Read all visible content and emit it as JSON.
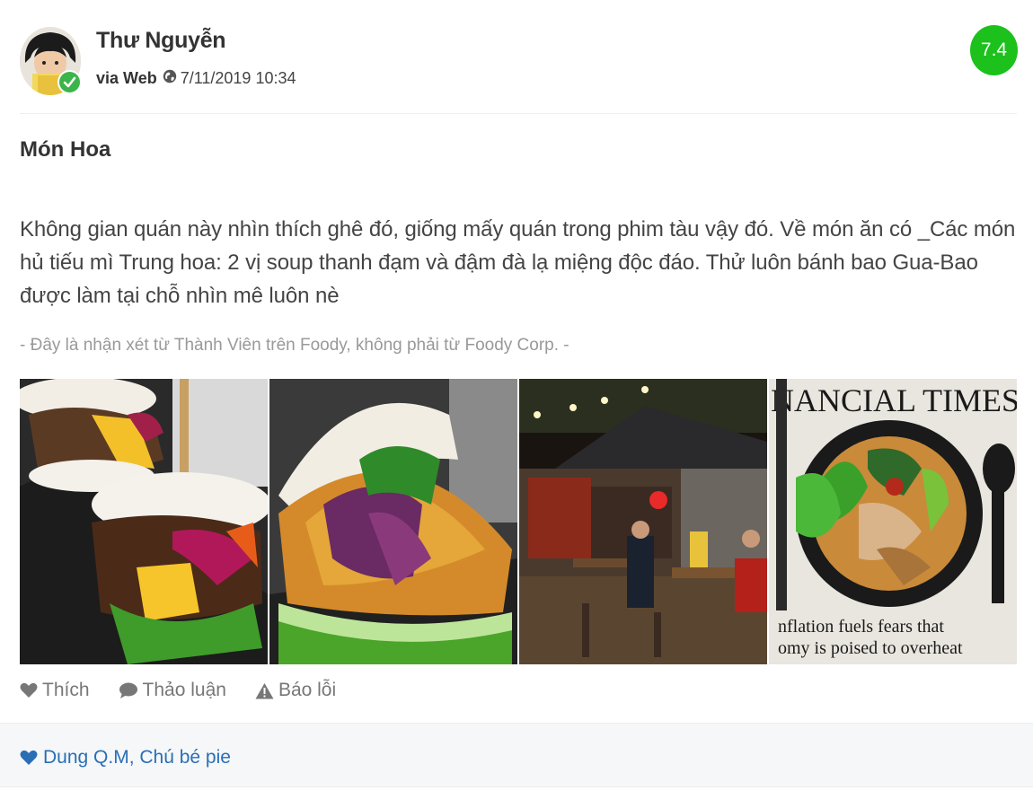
{
  "user": {
    "name": "Thư Nguyễn",
    "via_label": "via Web",
    "date": "7/11/2019 10:34",
    "avatar_icon": "user-avatar",
    "verified_icon": "check-icon"
  },
  "score": "7.4",
  "review": {
    "title": "Món Hoa",
    "text": "Không gian quán này nhìn thích ghê đó, giống mấy quán trong phim tàu vậy đó. Về món ăn có _Các món hủ tiếu mì Trung hoa: 2 vị soup thanh đạm và đậm đà lạ miệng độc đáo. Thử luôn bánh bao Gua-Bao được làm tại chỗ nhìn mê luôn nè",
    "disclaimer": "- Đây là nhận xét từ Thành Viên trên Foody, không phải từ Foody Corp. -"
  },
  "photos": {
    "newspaper_headline": "NANCIAL TIMES",
    "newspaper_line1": "nflation fuels fears that",
    "newspaper_line2": "omy is poised to overheat"
  },
  "actions": {
    "like": "Thích",
    "discuss": "Thảo luận",
    "report": "Báo lỗi"
  },
  "likes": {
    "names": "Dung Q.M, Chú bé pie"
  },
  "colors": {
    "score_bg": "#1cc11c",
    "verified": "#3bb54a",
    "link": "#2a6fb6"
  }
}
